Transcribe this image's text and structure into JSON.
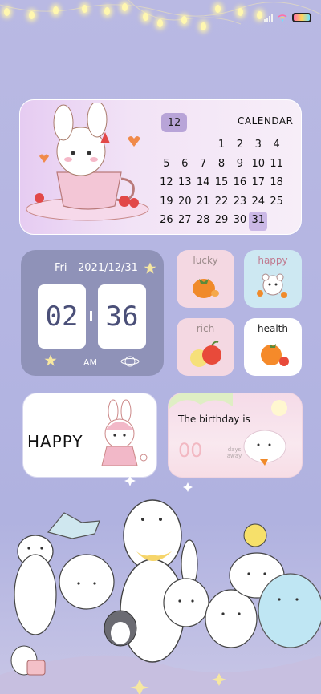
{
  "colors": {
    "background": "#b6b6e2",
    "clock_card": "#8f92b8",
    "calendar_highlight": "#cbb8e6",
    "accent_pink": "#f2b8c2"
  },
  "calendar": {
    "month": "12",
    "title": "CALENDAR",
    "rows": [
      [
        "",
        "",
        "",
        "",
        "1",
        "2",
        "3",
        "4"
      ],
      [
        "5",
        "6",
        "7",
        "8",
        "9",
        "10",
        "11"
      ],
      [
        "12",
        "13",
        "14",
        "15",
        "16",
        "17",
        "18"
      ],
      [
        "19",
        "20",
        "21",
        "22",
        "23",
        "24",
        "25"
      ],
      [
        "26",
        "27",
        "28",
        "29",
        "30",
        "31",
        ""
      ]
    ],
    "today": "31"
  },
  "clock": {
    "day": "Fri",
    "date": "2021/12/31",
    "hours": "02",
    "minutes": "36",
    "ampm": "AM"
  },
  "tiles": [
    {
      "label": "lucky",
      "icon": "persimmon-icon"
    },
    {
      "label": "happy",
      "icon": "bear-icon"
    },
    {
      "label": "rich",
      "icon": "apple-icon"
    },
    {
      "label": "health",
      "icon": "orange-icon"
    }
  ],
  "happy_card": {
    "text": "HAPPY"
  },
  "birthday_card": {
    "text": "The birthday is",
    "count": "00",
    "unit": "days away"
  }
}
